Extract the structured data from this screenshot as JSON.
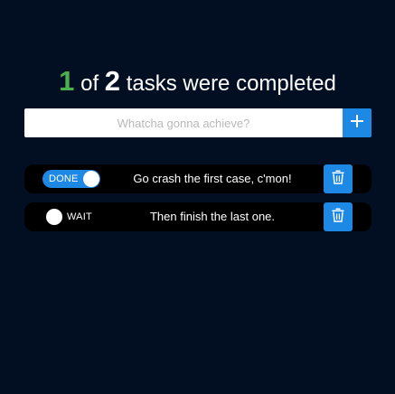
{
  "header": {
    "completed_count": "1",
    "of_text": "of",
    "total_count": "2",
    "suffix_text": "tasks were completed"
  },
  "add_task": {
    "placeholder": "Whatcha gonna achieve?",
    "value": "",
    "button_icon": "plus-icon"
  },
  "tasks": [
    {
      "status_label": "DONE",
      "done": true,
      "text": "Go crash the first case, c'mon!",
      "delete_icon": "trash-icon"
    },
    {
      "status_label": "WAIT",
      "done": false,
      "text": "Then finish the last one.",
      "delete_icon": "trash-icon"
    }
  ],
  "colors": {
    "background": "#020e22",
    "accent": "#1e88e5",
    "completed_count": "#4caf50",
    "task_row": "#000000"
  }
}
